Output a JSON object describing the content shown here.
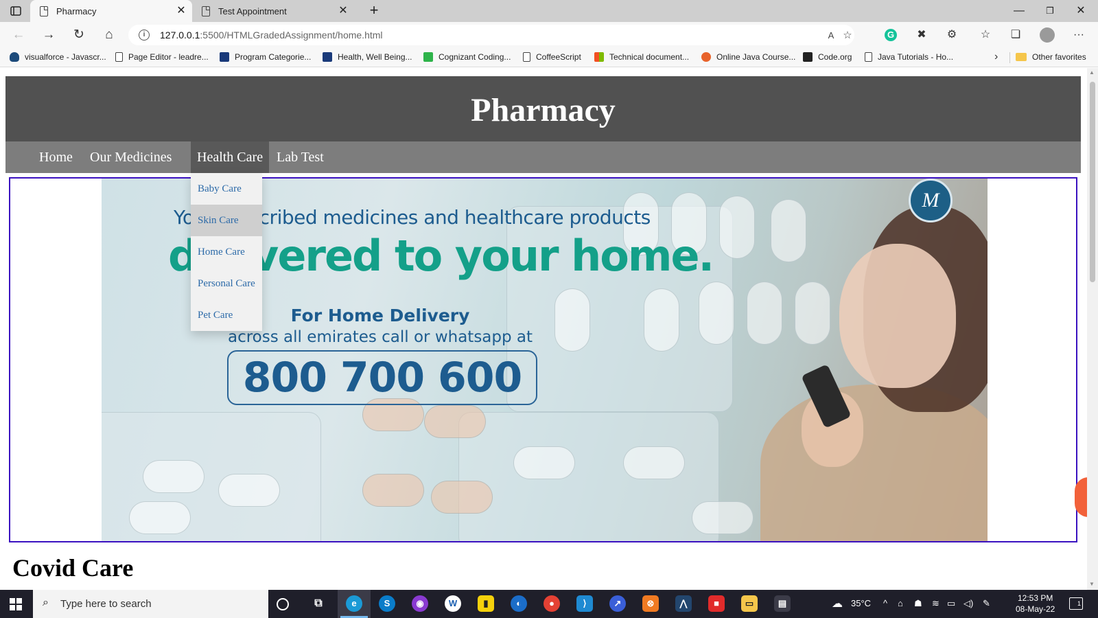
{
  "browser": {
    "tabs": [
      {
        "title": "Pharmacy",
        "active": true
      },
      {
        "title": "Test Appointment",
        "active": false
      }
    ],
    "url": {
      "host": "127.0.0.1",
      "path": ":5500/HTMLGradedAssignment/home.html"
    },
    "bookmarks": [
      "visualforce - Javascr...",
      "Page Editor - leadre...",
      "Program Categorie...",
      "Health, Well Being...",
      "Cognizant Coding...",
      "CoffeeScript",
      "Technical document...",
      "Online Java Course...",
      "Code.org",
      "Java Tutorials - Ho..."
    ],
    "other_favorites": "Other favorites"
  },
  "page": {
    "site_title": "Pharmacy",
    "nav": [
      "Home",
      "Our Medicines",
      "Health Care",
      "Lab Test"
    ],
    "dropdown": [
      "Baby Care",
      "Skin Care",
      "Home Care",
      "Personal Care",
      "Pet Care"
    ],
    "banner": {
      "line1": "Your prescribed medicines and healthcare products",
      "line2": "delivered to your home.",
      "line3": "For Home Delivery",
      "line4": "across all emirates call or whatsapp at",
      "phone": "800 700 600"
    },
    "section_heading": "Covid Care"
  },
  "taskbar": {
    "search_placeholder": "Type here to search",
    "weather": "35°C",
    "time": "12:53 PM",
    "date": "08-May-22",
    "notifications": "1"
  },
  "colors": {
    "header_bg": "#515151",
    "nav_bg": "#7d7d7d",
    "banner_border": "#3a10c0",
    "banner_green": "#14a089",
    "banner_blue": "#1d5c8f"
  }
}
